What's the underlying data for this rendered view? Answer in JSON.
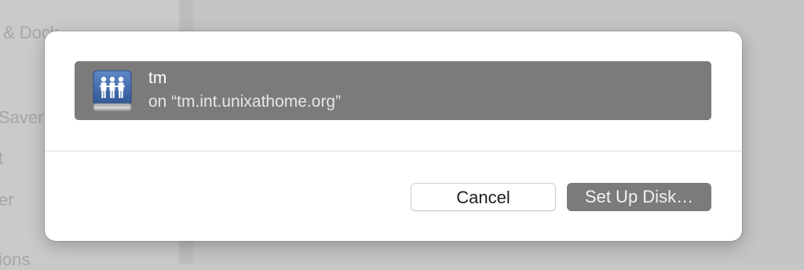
{
  "background": {
    "sidebar_fragments": [
      "& Dock",
      "Saver",
      "t",
      "er",
      "ions"
    ]
  },
  "dialog": {
    "disk": {
      "icon": "network-server-icon",
      "name": "tm",
      "location": "on “tm.int.unixathome.org”"
    },
    "buttons": {
      "cancel_label": "Cancel",
      "setup_label": "Set Up Disk…"
    }
  },
  "colors": {
    "selection": "#7b7b7b",
    "dialog_bg": "#ffffff",
    "disk_icon_blue": "#3f6aa8"
  }
}
